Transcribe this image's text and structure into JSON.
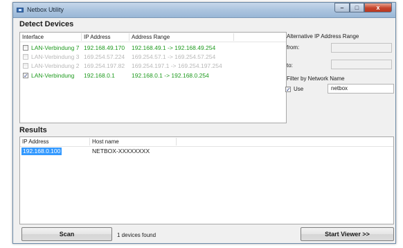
{
  "window": {
    "title": "Netbox Utility",
    "min_label": "–",
    "max_label": "□",
    "close_label": "x"
  },
  "detect": {
    "title": "Detect Devices",
    "headers": [
      "Interface",
      "IP Address",
      "Address Range"
    ],
    "rows": [
      {
        "checked": false,
        "interface": "LAN-Verbindung 7",
        "ip": "192.168.49.170",
        "range": "192.168.49.1 -> 192.168.49.254",
        "style": "green"
      },
      {
        "checked": false,
        "interface": "LAN-Verbindung 3",
        "ip": "169.254.57.224",
        "range": "169.254.57.1 -> 169.254.57.254",
        "style": "gray"
      },
      {
        "checked": false,
        "interface": "LAN-Verbindung 2",
        "ip": "169.254.197.82",
        "range": "169.254.197.1 -> 169.254.197.254",
        "style": "gray"
      },
      {
        "checked": true,
        "interface": "LAN-Verbindung",
        "ip": "192.168.0.1",
        "range": "192.168.0.1 -> 192.168.0.254",
        "style": "green"
      }
    ]
  },
  "alt_range": {
    "title": "Alternative IP Address Range",
    "from_label": "from:",
    "to_label": "to:",
    "from_value": "",
    "to_value": ""
  },
  "filter": {
    "title": "Filter by Network Name",
    "use_label": "Use",
    "use_checked": true,
    "value": "netbox"
  },
  "results": {
    "title": "Results",
    "headers": [
      "IP Address",
      "Host name"
    ],
    "rows": [
      {
        "ip": "192.168.0.100",
        "host": "NETBOX-XXXXXXXX",
        "selected": true
      }
    ]
  },
  "footer": {
    "scan_label": "Scan",
    "status": "1 devices found",
    "viewer_label": "Start Viewer >>"
  }
}
